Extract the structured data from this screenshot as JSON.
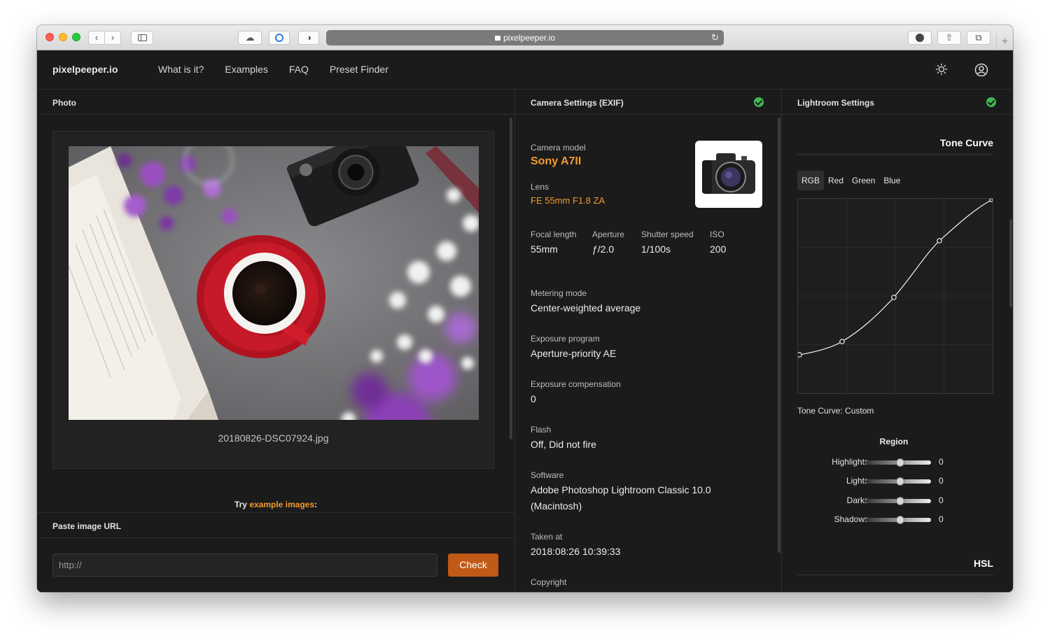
{
  "browser": {
    "url": "pixelpeeper.io"
  },
  "header": {
    "brand": "pixelpeeper.io",
    "nav": [
      "What is it?",
      "Examples",
      "FAQ",
      "Preset Finder"
    ]
  },
  "photo_panel": {
    "title": "Photo",
    "filename": "20180826-DSC07924.jpg",
    "try_prefix": "Try ",
    "try_link": "example images",
    "try_suffix": ":",
    "paste_title": "Paste image URL",
    "url_placeholder": "http://",
    "check_label": "Check"
  },
  "exif_panel": {
    "title": "Camera Settings (EXIF)",
    "camera_model_label": "Camera model",
    "camera_model": "Sony A7II",
    "lens_label": "Lens",
    "lens": "FE 55mm F1.8 ZA",
    "focal_length_label": "Focal length",
    "focal_length": "55mm",
    "aperture_label": "Aperture",
    "aperture": "ƒ/2.0",
    "shutter_label": "Shutter speed",
    "shutter": "1/100s",
    "iso_label": "ISO",
    "iso": "200",
    "metering_label": "Metering mode",
    "metering": "Center-weighted average",
    "program_label": "Exposure program",
    "program": "Aperture-priority AE",
    "compensation_label": "Exposure compensation",
    "compensation": "0",
    "flash_label": "Flash",
    "flash": "Off, Did not fire",
    "software_label": "Software",
    "software_line1": "Adobe Photoshop Lightroom Classic 10.0",
    "software_line2": "(Macintosh)",
    "taken_label": "Taken at",
    "taken": "2018:08:26 10:39:33",
    "copyright_label": "Copyright"
  },
  "lightroom_panel": {
    "title": "Lightroom Settings",
    "tone_curve_title": "Tone Curve",
    "tabs": [
      "RGB",
      "Red",
      "Green",
      "Blue"
    ],
    "active_tab": "RGB",
    "curve_caption": "Tone Curve: Custom",
    "region_title": "Region",
    "sliders": [
      {
        "label": "Highlights",
        "value": "0"
      },
      {
        "label": "Lights",
        "value": "0"
      },
      {
        "label": "Darks",
        "value": "0"
      },
      {
        "label": "Shadows",
        "value": "0"
      }
    ],
    "hsl_title": "HSL"
  },
  "colors": {
    "accent": "#f29a2e",
    "button": "#c05a16",
    "status_ok": "#3fb950",
    "background": "#1b1b1b"
  }
}
